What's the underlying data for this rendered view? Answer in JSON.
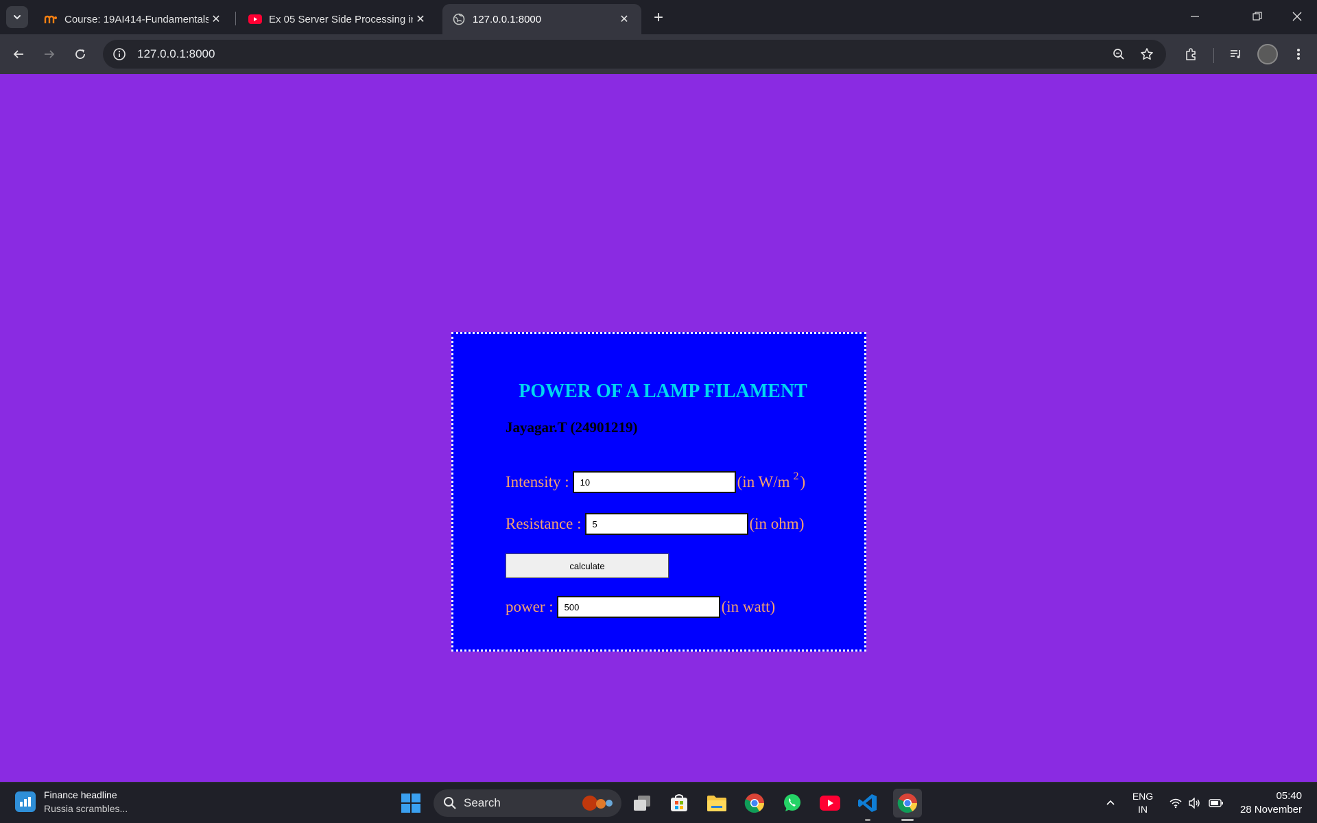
{
  "browser": {
    "tabs": [
      {
        "title": "Course: 19AI414-Fundamentals",
        "favicon": "moodle-icon"
      },
      {
        "title": "Ex 05 Server Side Processing in",
        "favicon": "youtube-icon"
      },
      {
        "title": "127.0.0.1:8000",
        "favicon": "globe-icon",
        "active": true
      }
    ],
    "url": "127.0.0.1:8000"
  },
  "page": {
    "title": "POWER OF A LAMP FILAMENT",
    "author": "Jayagar.T (24901219)",
    "intensity": {
      "label": "Intensity :",
      "value": "10",
      "unit_prefix": "(in W/m",
      "unit_sup": "2",
      "unit_suffix": ")"
    },
    "resistance": {
      "label": "Resistance :",
      "value": "5",
      "unit": "(in ohm)"
    },
    "button_label": "calculate",
    "power": {
      "label": "power :",
      "value": "500",
      "unit": "(in watt)"
    },
    "colors": {
      "background": "#8a2be2",
      "card": "#0000ff",
      "title": "#00d7f0",
      "label": "#f3a070"
    }
  },
  "taskbar": {
    "widget_title": "Finance headline",
    "widget_sub": "Russia scrambles...",
    "search_label": "Search",
    "lang_1": "ENG",
    "lang_2": "IN",
    "time": "05:40",
    "date": "28 November"
  }
}
